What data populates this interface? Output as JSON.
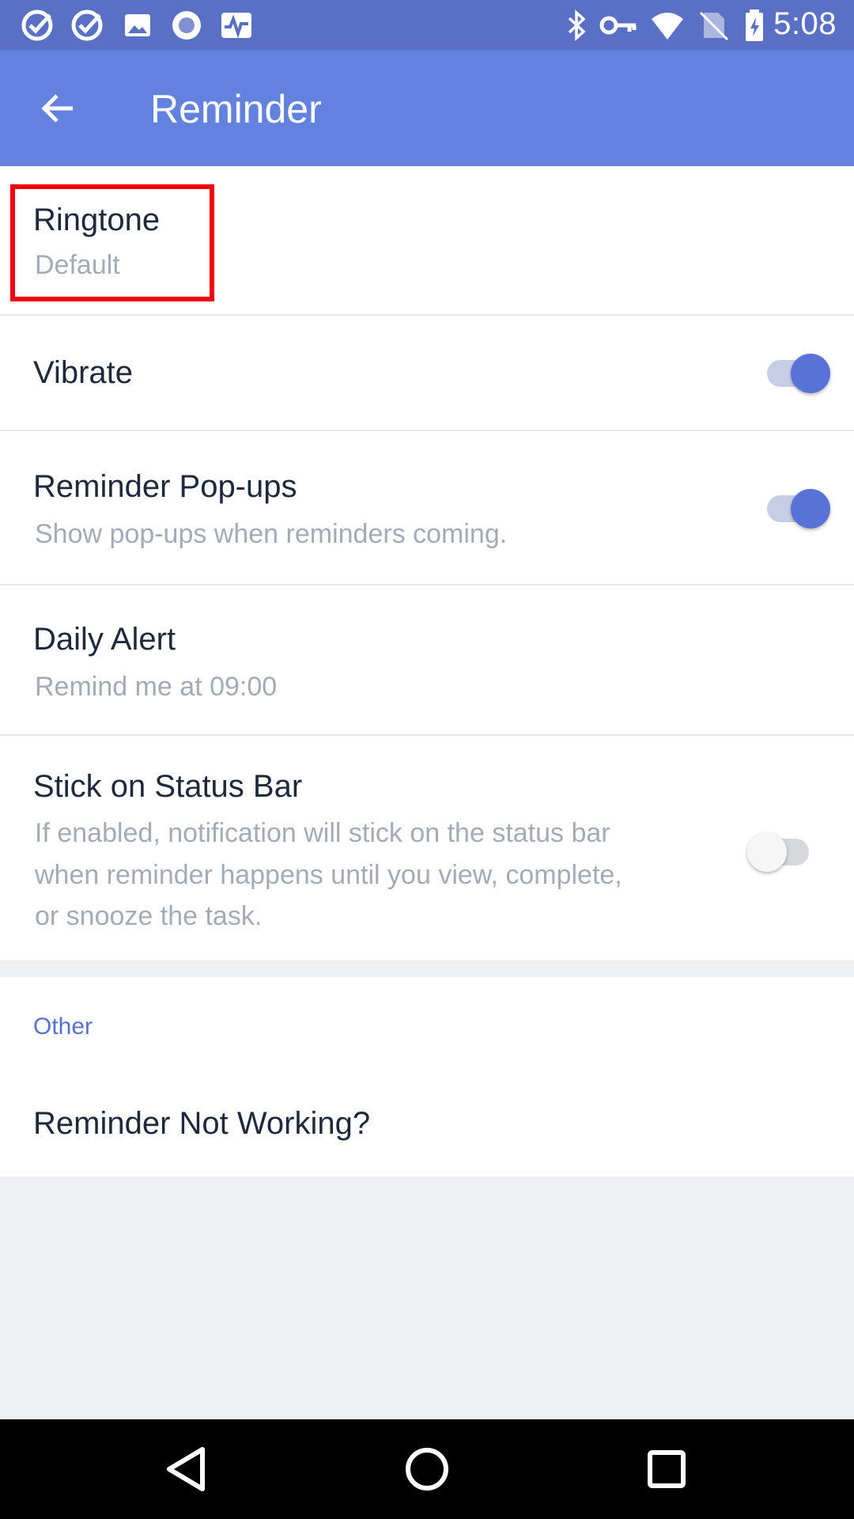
{
  "status_bar": {
    "time": "5:08",
    "left_icons": [
      "check-circle-icon",
      "check-circle-icon",
      "image-icon",
      "record-icon",
      "activity-icon"
    ],
    "right_icons": [
      "bluetooth-icon",
      "key-icon",
      "wifi-icon",
      "no-sim-icon",
      "battery-icon"
    ]
  },
  "toolbar": {
    "title": "Reminder",
    "background": "#6381df"
  },
  "settings": {
    "ringtone": {
      "title": "Ringtone",
      "subtitle": "Default"
    },
    "vibrate": {
      "title": "Vibrate",
      "enabled": true
    },
    "popups": {
      "title": "Reminder Pop-ups",
      "subtitle": "Show pop-ups when reminders coming.",
      "enabled": true
    },
    "daily_alert": {
      "title": "Daily Alert",
      "subtitle": "Remind me at 09:00"
    },
    "stick_status_bar": {
      "title": "Stick on Status Bar",
      "subtitle_lines": [
        "If enabled, notification will stick on the status bar",
        "when reminder happens until you view, complete,",
        "or snooze the task."
      ],
      "enabled": false
    }
  },
  "other_section": {
    "header": "Other",
    "items": [
      {
        "title": "Reminder Not Working?"
      }
    ]
  },
  "colors": {
    "accent": "#5872d8",
    "highlight_box": "#f2000f",
    "status_bar": "#5a70c4"
  }
}
